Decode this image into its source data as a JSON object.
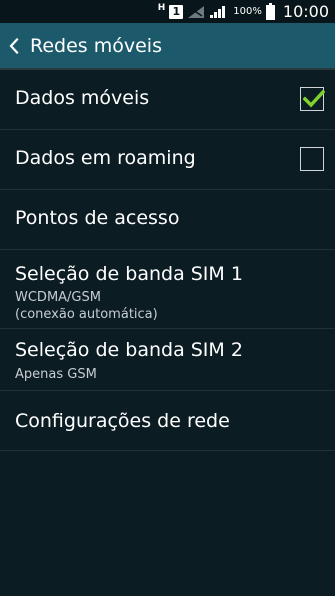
{
  "status_bar": {
    "network_type": "H",
    "sim_slot": "1",
    "battery_percent": "100%",
    "time": "10:00"
  },
  "action_bar": {
    "title": "Redes móveis"
  },
  "items": [
    {
      "title": "Dados móveis",
      "checked": true
    },
    {
      "title": "Dados em roaming",
      "checked": false
    },
    {
      "title": "Pontos de acesso"
    },
    {
      "title": "Seleção de banda SIM 1",
      "subtitle_line1": "WCDMA/GSM",
      "subtitle_line2": "(conexão automática)"
    },
    {
      "title": "Seleção de banda SIM 2",
      "subtitle_line1": "Apenas GSM"
    },
    {
      "title": "Configurações de rede"
    }
  ],
  "colors": {
    "background": "#0b1c23",
    "action_bar": "#1c5a6b",
    "check": "#7fd12b"
  }
}
